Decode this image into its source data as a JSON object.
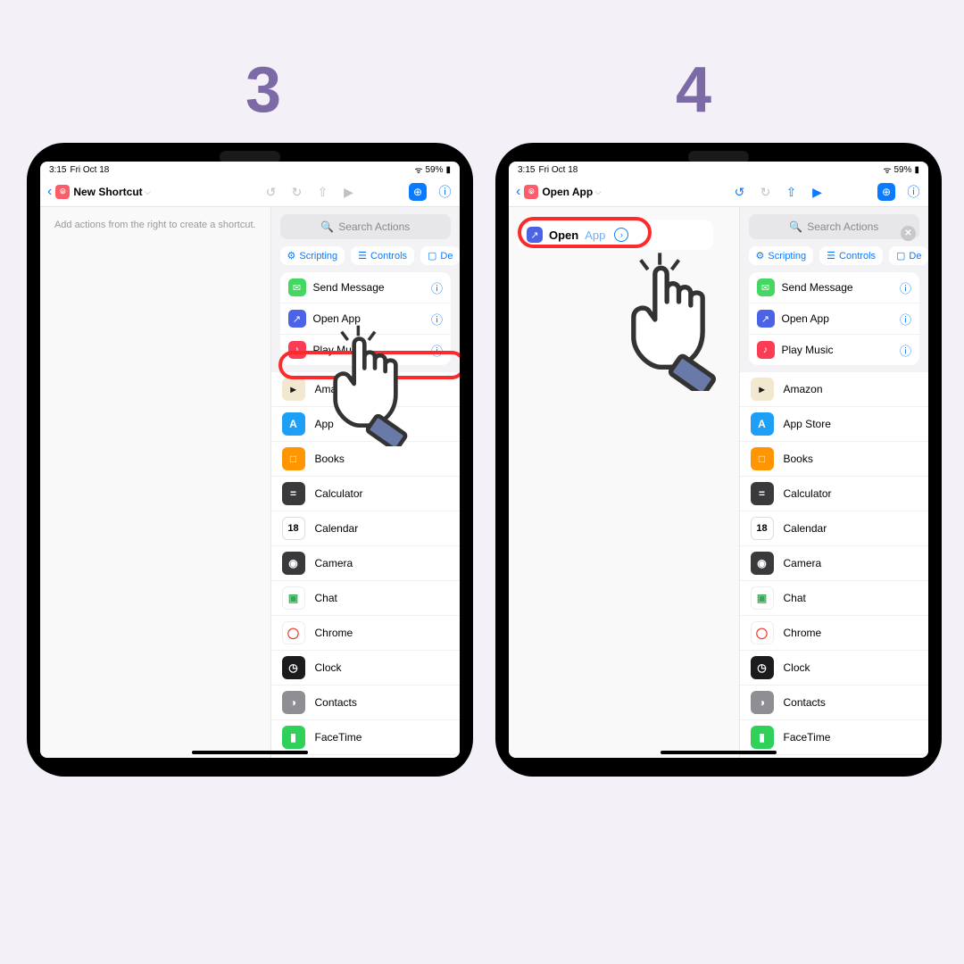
{
  "steps": {
    "s3": "3",
    "s4": "4"
  },
  "status": {
    "time": "3:15",
    "date": "Fri Oct 18",
    "battery": "59%",
    "wifi": "wifi"
  },
  "titles": {
    "step3": "New Shortcut",
    "step4": "Open App"
  },
  "canvas": {
    "hint": "Add actions from the right to create a shortcut."
  },
  "search": {
    "placeholder": "Search Actions"
  },
  "pills": [
    {
      "icon": "gear",
      "label": "Scripting"
    },
    {
      "icon": "slider",
      "label": "Controls"
    },
    {
      "icon": "device",
      "label": "De"
    }
  ],
  "actions": [
    {
      "name": "send-message",
      "label": "Send Message",
      "bg": "#44d862",
      "glyph": "msg"
    },
    {
      "name": "open-app",
      "label": "Open App",
      "bg": "#4b63e6",
      "glyph": "arrow"
    },
    {
      "name": "play-music",
      "label": "Play Music",
      "bg": "#fc3b55",
      "glyph": "note"
    }
  ],
  "apps": [
    {
      "name": "amazon",
      "label": "Amazon",
      "bg": "#f2e8cf",
      "g": "▸",
      "fg": "#1a1a1a"
    },
    {
      "name": "app-store",
      "label": "App Store",
      "bg": "#1e9ff7",
      "g": "A"
    },
    {
      "name": "books",
      "label": "Books",
      "bg": "#ff9500",
      "g": "□"
    },
    {
      "name": "calculator",
      "label": "Calculator",
      "bg": "#3a3a3c",
      "g": "="
    },
    {
      "name": "calendar",
      "label": "Calendar",
      "bg": "#fff",
      "g": "18",
      "fg": "#000",
      "br": "1px solid #ddd",
      "fs": "11px"
    },
    {
      "name": "camera",
      "label": "Camera",
      "bg": "#3a3a3c",
      "g": "◉"
    },
    {
      "name": "chat",
      "label": "Chat",
      "bg": "#fff",
      "g": "▣",
      "fg": "#34a853",
      "br": "1px solid #eee"
    },
    {
      "name": "chrome",
      "label": "Chrome",
      "bg": "#fff",
      "g": "◯",
      "fg": "#ea4335",
      "br": "1px solid #eee"
    },
    {
      "name": "clock",
      "label": "Clock",
      "bg": "#1c1c1e",
      "g": "◷"
    },
    {
      "name": "contacts",
      "label": "Contacts",
      "bg": "#8e8e93",
      "g": "◑"
    },
    {
      "name": "facetime",
      "label": "FaceTime",
      "bg": "#30d158",
      "g": "▮"
    }
  ],
  "block": {
    "verb": "Open",
    "param": "App"
  }
}
